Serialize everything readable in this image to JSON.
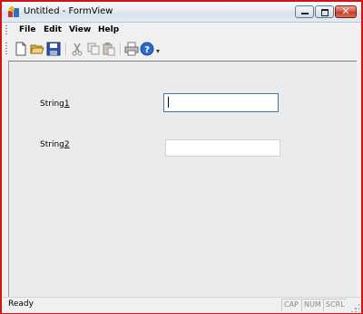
{
  "window": {
    "title": "Untitled - FormView",
    "caption_buttons": [
      "minimize-icon",
      "maximize-icon",
      "close-icon"
    ],
    "close_glyph": "✕",
    "border_color": "#d11414"
  },
  "menu": {
    "items": [
      "File",
      "Edit",
      "View",
      "Help"
    ]
  },
  "toolbar": {
    "buttons": [
      "new-file-icon",
      "open-folder-icon",
      "save-icon",
      "cut-icon",
      "copy-icon",
      "paste-icon",
      "print-icon",
      "help-icon"
    ],
    "overflow_glyph": "▾"
  },
  "form": {
    "string1": {
      "label_prefix": "String",
      "label_mnemonic": "1",
      "value": "",
      "focused": true
    },
    "string2": {
      "label_prefix": "String",
      "label_mnemonic": "2",
      "value": ""
    }
  },
  "status": {
    "text": "Ready",
    "indicators": [
      "CAP",
      "NUM",
      "SCRL"
    ]
  }
}
